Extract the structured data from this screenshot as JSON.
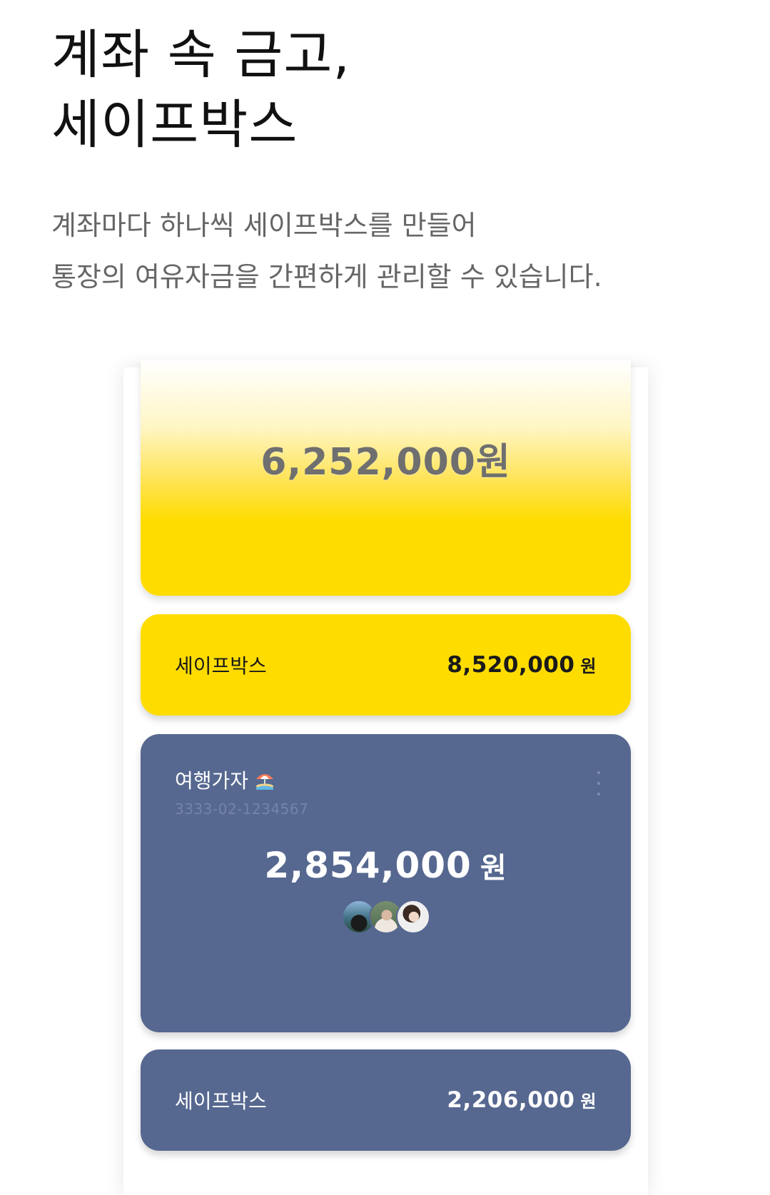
{
  "headline": {
    "line1": "계좌 속 금고,",
    "line2": "세이프박스"
  },
  "description": {
    "line1": "계좌마다 하나씩 세이프박스를 만들어",
    "line2": "통장의 여유자금을 간편하게 관리할 수 있습니다."
  },
  "main_card": {
    "balance": "6,252,000원"
  },
  "yellow_safebox": {
    "label": "세이프박스",
    "amount": "8,520,000",
    "unit": "원"
  },
  "travel_account": {
    "name": "여행가자",
    "icon": "beach-umbrella-icon",
    "account_number": "3333-02-1234567",
    "balance": "2,854,000",
    "unit": "원",
    "members": [
      "member-1",
      "member-2",
      "member-3"
    ]
  },
  "blue_safebox": {
    "label": "세이프박스",
    "amount": "2,206,000",
    "unit": "원"
  },
  "colors": {
    "yellow": "#ffdc00",
    "slate_blue": "#566890"
  }
}
